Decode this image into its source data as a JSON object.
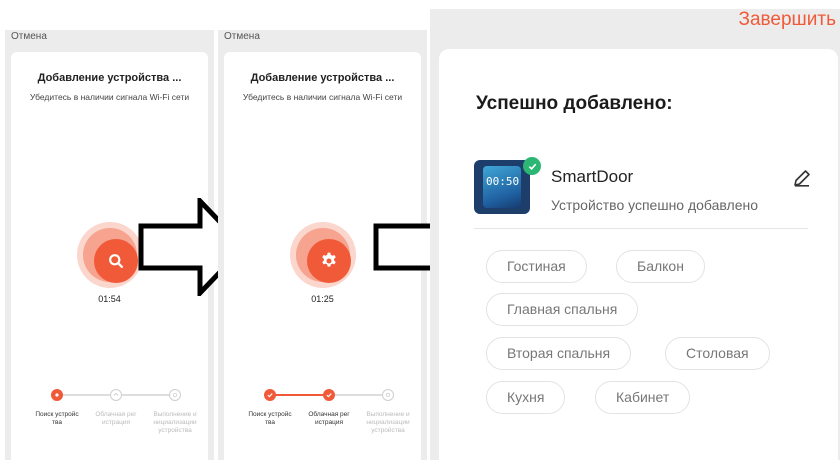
{
  "screens": [
    {
      "cancel_label": "Отмена",
      "title": "Добавление устройства ...",
      "subtitle": "Убедитесь в наличии сигнала Wi-Fi сети",
      "icon": "search-icon",
      "timer": "01:54",
      "steps": [
        {
          "label": "Поиск устройства",
          "state": "active"
        },
        {
          "label": "Облачная регистрация",
          "state": "pending"
        },
        {
          "label": "Выполнение инициализации устройства",
          "state": "pending"
        }
      ]
    },
    {
      "cancel_label": "Отмена",
      "title": "Добавление устройства ...",
      "subtitle": "Убедитесь в наличии сигнала Wi-Fi сети",
      "icon": "gear-icon",
      "timer": "01:25",
      "steps": [
        {
          "label": "Поиск устройства",
          "state": "done"
        },
        {
          "label": "Облачная регистрация",
          "state": "active"
        },
        {
          "label": "Выполнение инициализации устройства",
          "state": "pending"
        }
      ]
    }
  ],
  "result": {
    "finish_label": "Завершить",
    "title": "Успешно добавлено:",
    "device": {
      "name": "SmartDoor",
      "status": "Устройство успешно добавлено",
      "thumbnail_clock": "00:50"
    },
    "rooms": [
      "Гостиная",
      "Балкон",
      "Главная спальня",
      "Вторая спальня",
      "Столовая",
      "Кухня",
      "Кабинет"
    ]
  },
  "colors": {
    "accent": "#f05a38",
    "success": "#2bb673",
    "background": "#ececec"
  }
}
